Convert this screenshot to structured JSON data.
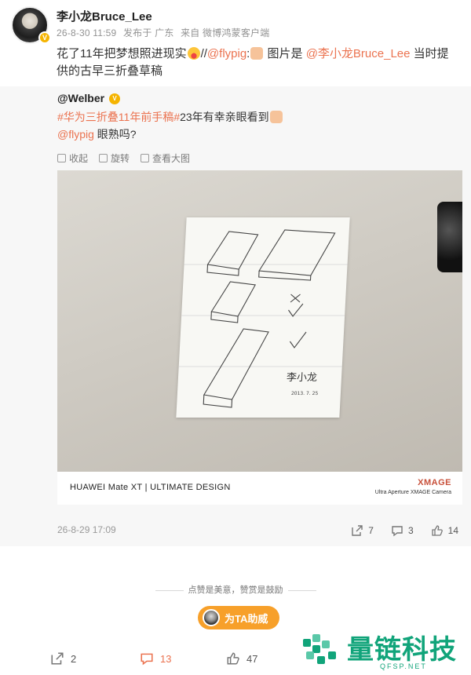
{
  "post": {
    "username": "李小龙Bruce_Lee",
    "time": "26-8-30 11:59",
    "location": "发布于 广东",
    "source": "来自 微博鸿蒙客户端",
    "text_before": "花了11年把梦想照进现实",
    "text_mid1": "//",
    "mention1": "@flypig",
    "text_colon": ":",
    "text_mid2": " 图片是 ",
    "mention2": "@李小龙Bruce_Lee",
    "text_after": " 当时提供的古早三折叠草稿"
  },
  "repost": {
    "username": "@Welber",
    "hashtag1": "#华为三折叠11年前手稿#",
    "text1": "23年有幸亲眼看到",
    "mention": "@flypig",
    "text2": " 眼熟吗?",
    "toolbar": {
      "collapse": "收起",
      "rotate": "旋转",
      "view_large": "查看大图"
    },
    "caption_model": "HUAWEI Mate XT | ULTIMATE DESIGN",
    "caption_brand": "XMAGE",
    "caption_sub": "Ultra Aperture XMAGE Camera",
    "signature": "李小龙",
    "sign_date": "2013. 7. 25",
    "time": "26-8-29 17:09",
    "reposts": "7",
    "comments": "3",
    "likes": "14"
  },
  "reward": {
    "slogan": "点赞是美意，赞赏是鼓励",
    "button": "为TA助威"
  },
  "actions": {
    "reposts": "2",
    "comments": "13",
    "likes": "47"
  },
  "watermark": {
    "text": "量链科技",
    "sub": "QFSP.NET"
  },
  "colors": {
    "accent": "#eb7350",
    "verified": "#f5b400",
    "reward": "#f7a02a",
    "watermark": "#11a47a"
  }
}
